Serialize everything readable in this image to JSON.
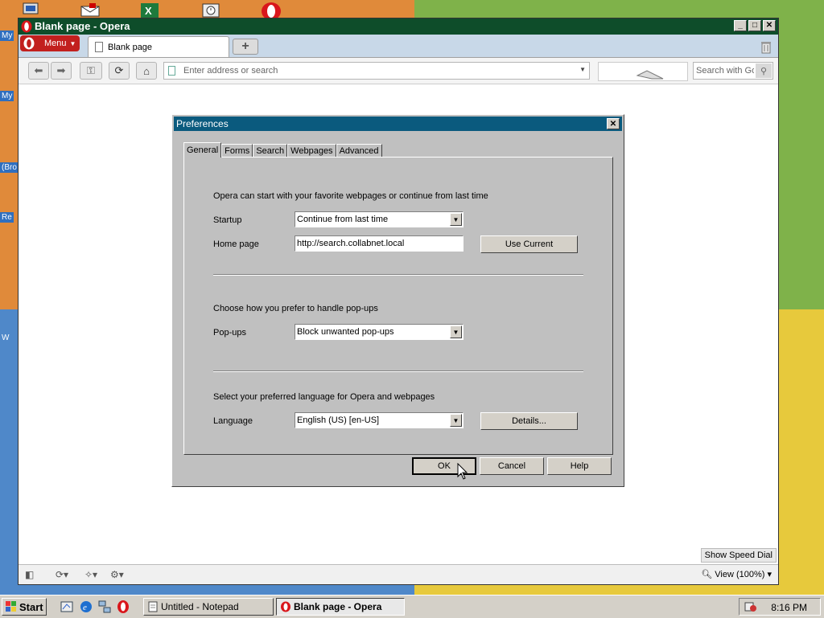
{
  "window": {
    "title": "Blank page - Opera",
    "menu_label": "Menu",
    "tab_label": "Blank page",
    "new_tab_symbol": "+"
  },
  "toolbar": {
    "address_placeholder": "Enter address or search",
    "search_placeholder": "Search with Google"
  },
  "content": {
    "speed_dial_label": "Show Speed Dial"
  },
  "statusbar": {
    "zoom_label": "View (100%)"
  },
  "dialog": {
    "title": "Preferences",
    "tabs": [
      "General",
      "Forms",
      "Search",
      "Webpages",
      "Advanced"
    ],
    "startup_intro": "Opera can start with your favorite webpages or continue from last time",
    "startup_label": "Startup",
    "startup_value": "Continue from last time",
    "homepage_label": "Home page",
    "homepage_value": "http://search.collabnet.local",
    "use_current_label": "Use Current",
    "popups_intro": "Choose how you prefer to handle pop-ups",
    "popups_label": "Pop-ups",
    "popups_value": "Block unwanted pop-ups",
    "language_intro": "Select your preferred language for Opera and webpages",
    "language_label": "Language",
    "language_value": "English (US) [en-US]",
    "details_label": "Details...",
    "ok_label": "OK",
    "cancel_label": "Cancel",
    "help_label": "Help"
  },
  "desktop": {
    "edge_labels": [
      "My",
      "My",
      "(Bro",
      "Re",
      "W"
    ]
  },
  "taskbar": {
    "start_label": "Start",
    "tasks": [
      "Untitled - Notepad",
      "Blank page - Opera"
    ],
    "clock": "8:16 PM"
  },
  "colors": {
    "opera_red": "#c2201e",
    "title_green": "#0e4d2a",
    "dialog_title_blue": "#0a5a7e"
  }
}
